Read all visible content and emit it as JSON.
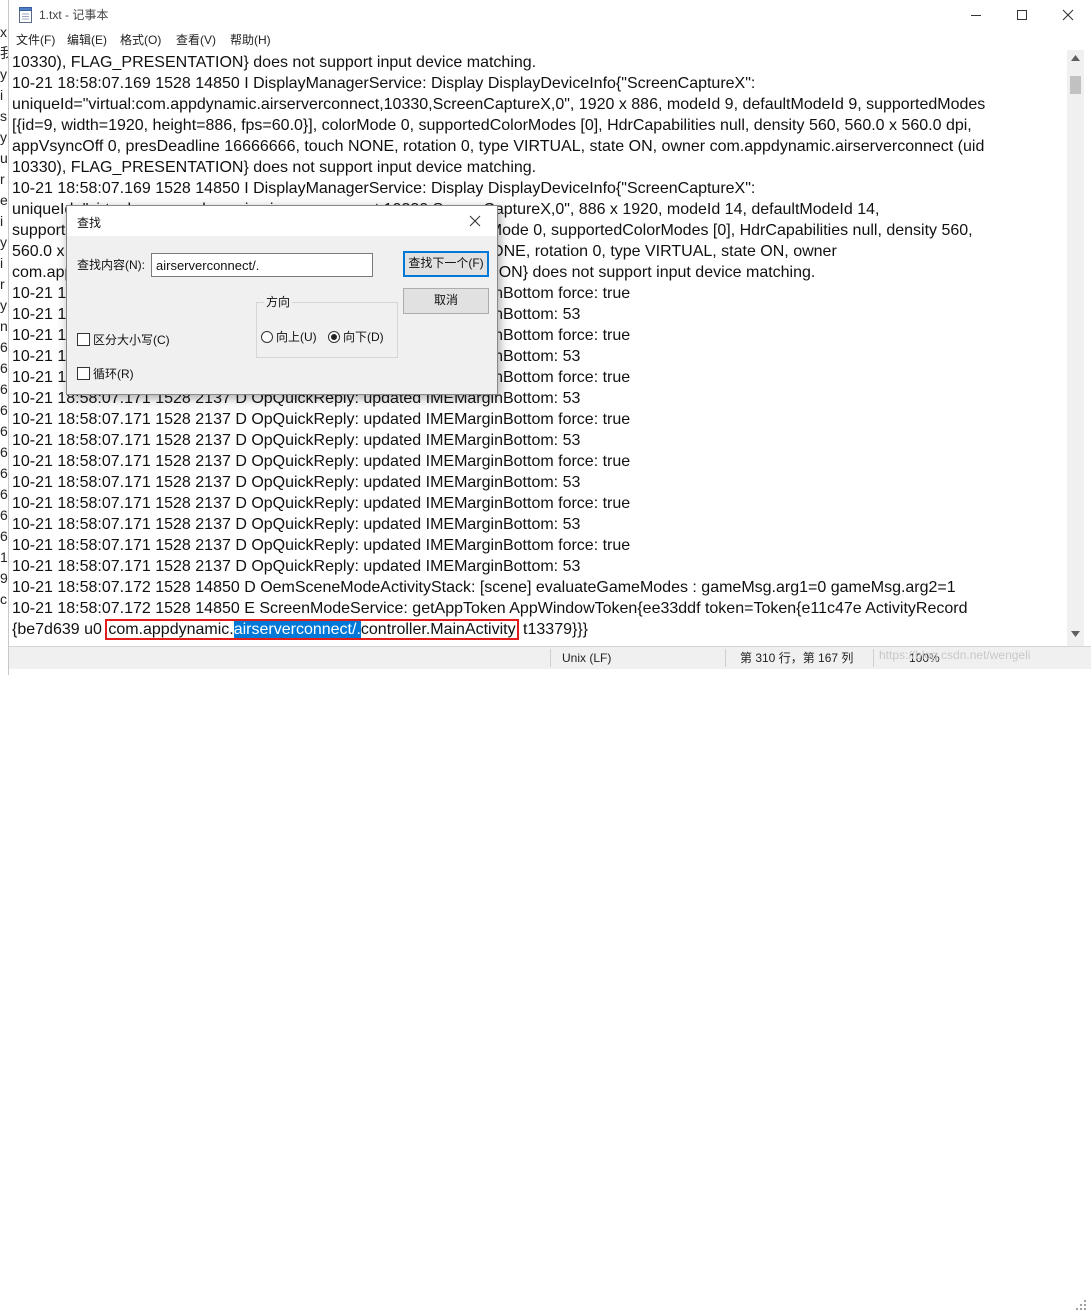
{
  "window": {
    "title": "1.txt - 记事本",
    "bg_window_chars": [
      "x",
      "我",
      "y",
      "i",
      "s",
      "y",
      "u",
      "r",
      "e",
      "i",
      "y",
      "i",
      "r",
      "y",
      "n",
      "6",
      "6",
      "6",
      "6",
      "6",
      "6",
      "6",
      "6",
      "6",
      "6",
      "1",
      "9",
      "c"
    ]
  },
  "menu": [
    "文件(F)",
    "编辑(E)",
    "格式(O)",
    "查看(V)",
    "帮助(H)"
  ],
  "editor": {
    "lines": [
      "10330), FLAG_PRESENTATION} does not support input device matching.",
      "10-21 18:58:07.169  1528 14850 I DisplayManagerService: Display DisplayDeviceInfo{\"ScreenCaptureX\":",
      "uniqueId=\"virtual:com.appdynamic.airserverconnect,10330,ScreenCaptureX,0\", 1920 x 886, modeId 9, defaultModeId 9, supportedModes",
      "[{id=9, width=1920, height=886, fps=60.0}], colorMode 0, supportedColorModes [0], HdrCapabilities null, density 560, 560.0 x 560.0 dpi,",
      "appVsyncOff 0, presDeadline 16666666, touch NONE, rotation 0, type VIRTUAL, state ON, owner com.appdynamic.airserverconnect (uid",
      "10330), FLAG_PRESENTATION} does not support input device matching.",
      "10-21 18:58:07.169  1528 14850 I DisplayManagerService: Display DisplayDeviceInfo{\"ScreenCaptureX\":",
      "uniqueId=\"virtual:com.appdynamic.airserverconnect,10330,ScreenCaptureX,0\", 886 x 1920, modeId 14, defaultModeId 14,",
      "supportedModes [{id=14, width=886, height=1920, fps=60.0}], colorMode 0, supportedColorModes [0], HdrCapabilities null, density 560,",
      "560.0 x 560.0 dpi, appVsyncOff 0, presDeadline 16666666, touch NONE, rotation 0, type VIRTUAL, state ON, owner",
      "com.appdynamic.airserverconnect (uid 10330), FLAG_PRESENTATION} does not support input device matching.",
      "10-21 18:58:07.171  1528  2137 D OpQuickReply: updated IMEMarginBottom force: true",
      "10-21 18:58:07.171  1528  2137 D OpQuickReply: updated IMEMarginBottom: 53",
      "10-21 18:58:07.171  1528  2137 D OpQuickReply: updated IMEMarginBottom force: true",
      "10-21 18:58:07.171  1528  2137 D OpQuickReply: updated IMEMarginBottom: 53",
      "10-21 18:58:07.171  1528  2137 D OpQuickReply: updated IMEMarginBottom force: true",
      "10-21 18:58:07.171  1528  2137 D OpQuickReply: updated IMEMarginBottom: 53",
      "10-21 18:58:07.171  1528  2137 D OpQuickReply: updated IMEMarginBottom force: true",
      "10-21 18:58:07.171  1528  2137 D OpQuickReply: updated IMEMarginBottom: 53",
      "10-21 18:58:07.171  1528  2137 D OpQuickReply: updated IMEMarginBottom force: true",
      "10-21 18:58:07.171  1528  2137 D OpQuickReply: updated IMEMarginBottom: 53",
      "10-21 18:58:07.171  1528  2137 D OpQuickReply: updated IMEMarginBottom force: true",
      "10-21 18:58:07.171  1528  2137 D OpQuickReply: updated IMEMarginBottom: 53",
      "10-21 18:58:07.171  1528  2137 D OpQuickReply: updated IMEMarginBottom force: true",
      "10-21 18:58:07.171  1528  2137 D OpQuickReply: updated IMEMarginBottom: 53",
      "10-21 18:58:07.172  1528 14850 D OemSceneModeActivityStack: [scene] evaluateGameModes :  gameMsg.arg1=0 gameMsg.arg2=1",
      "10-21 18:58:07.172  1528 14850 E ScreenModeService: getAppToken AppWindowToken{ee33ddf token=Token{e11c47e ActivityRecord"
    ],
    "highlight_line": {
      "prefix": "{be7d639 u0 ",
      "boxed_before": "com.appdynamic.",
      "selected": "airserverconnect/.",
      "boxed_after": "controller.MainActivity",
      "suffix": " t13379}}}"
    }
  },
  "statusbar": {
    "encoding": "Unix (LF)",
    "position": "第 310 行，第 167 列",
    "zoom": "100%",
    "watermark": "https://blog.csdn.net/wengeli"
  },
  "find_dialog": {
    "title": "查找",
    "find_label": "查找内容(N):",
    "find_value": "airserverconnect/.",
    "find_next_label": "查找下一个(F)",
    "cancel_label": "取消",
    "direction_label": "方向",
    "up_label": "向上(U)",
    "down_label": "向下(D)",
    "direction": "down",
    "match_case_label": "区分大小写(C)",
    "match_case": false,
    "wrap_label": "循环(R)",
    "wrap": false
  },
  "icons": {
    "app": "notepad-icon",
    "minimize": "minimize-icon",
    "maximize": "maximize-icon",
    "close": "close-icon"
  }
}
